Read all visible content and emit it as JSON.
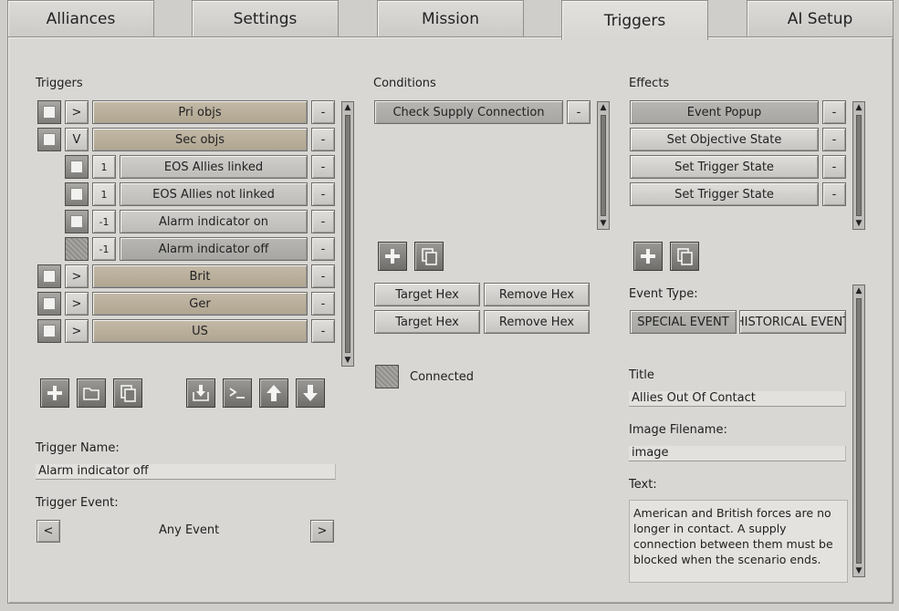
{
  "tabs": [
    "Alliances",
    "Settings",
    "Mission",
    "Triggers",
    "AI Setup"
  ],
  "triggers": {
    "header": "Triggers",
    "rows": [
      {
        "expander": ">",
        "label": "Pri objs",
        "remove": "-",
        "checked": true
      },
      {
        "expander": "V",
        "label": "Sec objs",
        "remove": "-",
        "checked": true
      },
      {
        "expander": "1",
        "label": "EOS Allies linked",
        "remove": "-",
        "checked": true
      },
      {
        "expander": "1",
        "label": "EOS Allies not linked",
        "remove": "-",
        "checked": true
      },
      {
        "expander": "-1",
        "label": "Alarm indicator on",
        "remove": "-",
        "checked": true
      },
      {
        "expander": "-1",
        "label": "Alarm indicator off",
        "remove": "-",
        "checked": false
      },
      {
        "expander": ">",
        "label": "Brit",
        "remove": "-",
        "checked": true
      },
      {
        "expander": ">",
        "label": "Ger",
        "remove": "-",
        "checked": true
      },
      {
        "expander": ">",
        "label": "US",
        "remove": "-",
        "checked": true
      }
    ],
    "toolbar_icons": [
      "plus-icon",
      "folder-icon",
      "copy-icon",
      "import-icon",
      "console-icon",
      "arrow-up-icon",
      "arrow-down-icon"
    ],
    "name_label": "Trigger Name:",
    "name_value": "Alarm indicator off",
    "event_label": "Trigger Event:",
    "event_prev": "<",
    "event_value": "Any Event",
    "event_next": ">"
  },
  "conditions": {
    "header": "Conditions",
    "items": [
      {
        "label": "Check Supply Connection",
        "remove": "-"
      }
    ],
    "hex_buttons": [
      {
        "left": "Target Hex",
        "right": "Remove Hex"
      },
      {
        "left": "Target Hex",
        "right": "Remove Hex"
      }
    ],
    "connected_label": "Connected"
  },
  "effects": {
    "header": "Effects",
    "items": [
      {
        "label": "Event Popup",
        "remove": "-"
      },
      {
        "label": "Set Objective State",
        "remove": "-"
      },
      {
        "label": "Set Trigger State",
        "remove": "-"
      },
      {
        "label": "Set Trigger State",
        "remove": "-"
      }
    ],
    "event_type_label": "Event Type:",
    "event_types": [
      "SPECIAL EVENT",
      "HISTORICAL EVENT"
    ],
    "title_label": "Title",
    "title_value": "Allies Out Of Contact",
    "image_label": "Image Filename:",
    "image_value": "image",
    "text_label": "Text:",
    "text_value": "American and British forces are no longer in contact. A supply connection between them must be blocked when the scenario ends."
  }
}
